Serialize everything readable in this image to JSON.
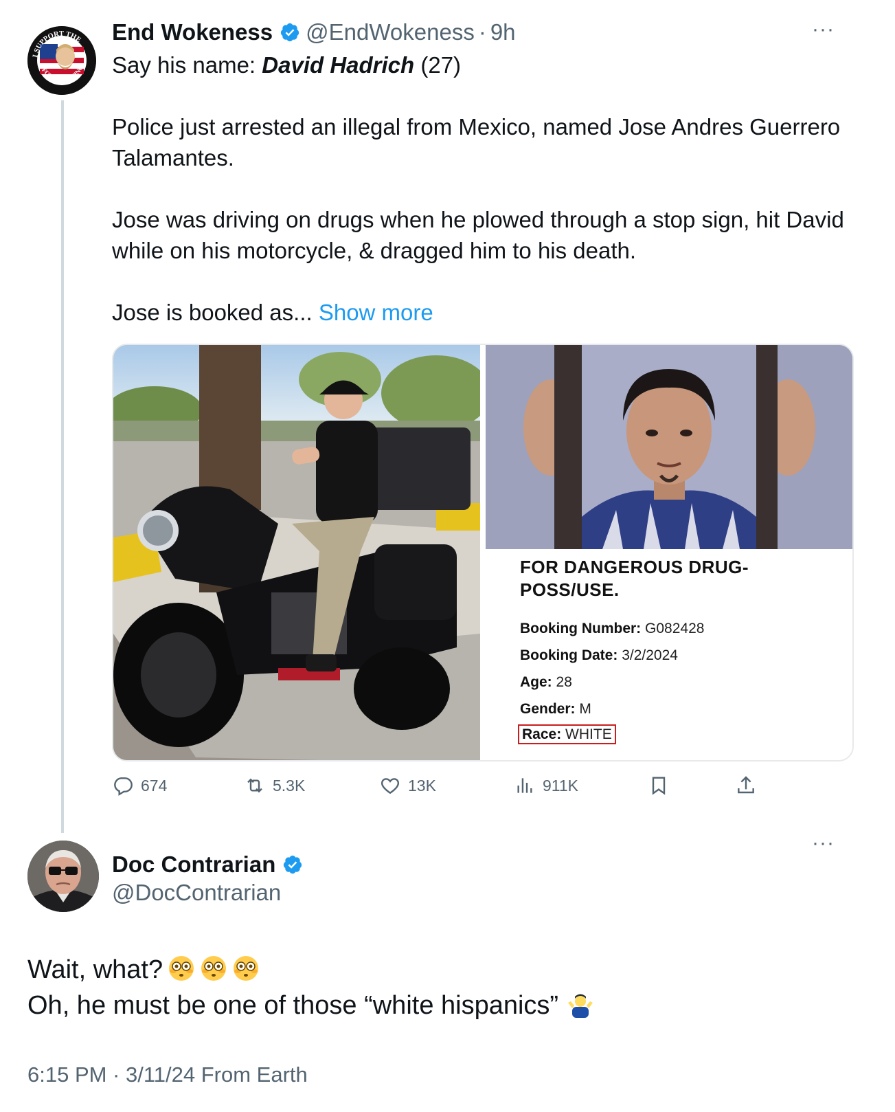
{
  "tweet1": {
    "author_name": "End Wokeness",
    "handle": "@EndWokeness",
    "separator": "·",
    "time": "9h",
    "more_label": "···",
    "avatar_ring_top": "I SUPPORT THE",
    "avatar_ring_bottom": "FORMER THING",
    "line1_prefix": "Say his name: ",
    "line1_name": "David Hadrich",
    "line1_suffix": " (27)",
    "para2": "Police just arrested an illegal from Mexico, named Jose Andres Guerrero Talamantes.",
    "para3": "Jose was driving on drugs when he plowed through a stop sign, hit David while on his motorcycle, & dragged him to his death.",
    "para4_prefix": "Jose is booked as... ",
    "show_more": "Show more",
    "booking": {
      "charge": "FOR DANGEROUS DRUG-POSS/USE.",
      "number_label": "Booking Number:",
      "number_value": "G082428",
      "date_label": "Booking Date:",
      "date_value": "3/2/2024",
      "age_label": "Age:",
      "age_value": "28",
      "gender_label": "Gender:",
      "gender_value": "M",
      "race_label": "Race:",
      "race_value": "WHITE"
    },
    "actions": {
      "replies": "674",
      "reposts": "5.3K",
      "likes": "13K",
      "views": "911K"
    }
  },
  "tweet2": {
    "author_name": "Doc Contrarian",
    "handle": "@DocContrarian",
    "more_label": "···",
    "line1": "Wait, what?",
    "line2": "Oh, he must be one of those “white hispanics”",
    "timestamp": "6:15 PM · 3/11/24 From Earth"
  },
  "colors": {
    "accent": "#1d9bf0",
    "secondary_text": "#536471",
    "thread_line": "#cfd9de",
    "race_highlight": "#c81e1e"
  },
  "icons": [
    "verified-badge-icon",
    "more-icon",
    "reply-icon",
    "repost-icon",
    "like-icon",
    "views-icon",
    "bookmark-icon",
    "share-icon",
    "flushed-face-emoji",
    "shrug-emoji"
  ]
}
